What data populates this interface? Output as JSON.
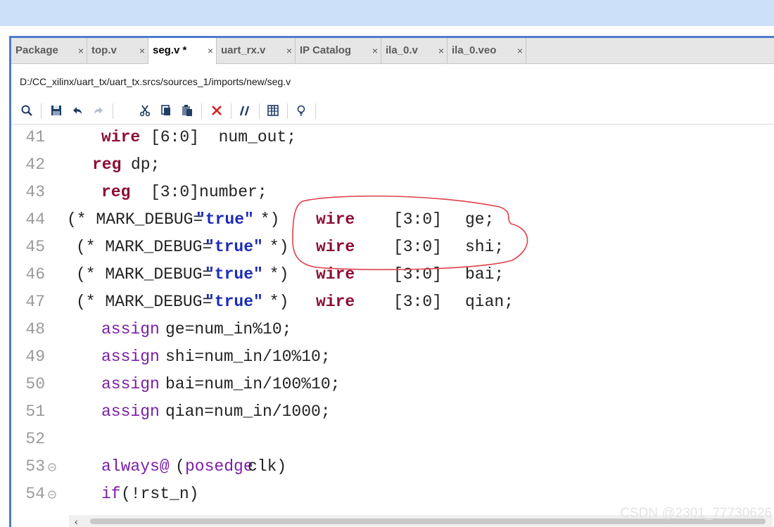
{
  "tabs": [
    {
      "label": "Package",
      "active": false
    },
    {
      "label": "top.v",
      "active": false
    },
    {
      "label": "seg.v *",
      "active": true
    },
    {
      "label": "uart_rx.v",
      "active": false
    },
    {
      "label": "IP Catalog",
      "active": false
    },
    {
      "label": "ila_0.v",
      "active": false
    },
    {
      "label": "ila_0.veo",
      "active": false
    }
  ],
  "tab_close_glyph": "×",
  "file_path": "D:/CC_xilinx/uart_tx/uart_tx.srcs/sources_1/imports/new/seg.v",
  "toolbar_icons": [
    "search-icon",
    "save-icon",
    "undo-icon",
    "redo-icon",
    "cut-icon",
    "copy-icon",
    "paste-icon",
    "delete-icon",
    "comment-icon",
    "columns-icon",
    "bulb-icon"
  ],
  "code": {
    "lines": [
      {
        "n": "41",
        "t": [
          "wire",
          "[6:0]  num_out;"
        ]
      },
      {
        "n": "42",
        "t": [
          "reg",
          "dp;"
        ]
      },
      {
        "n": "43",
        "t": [
          "reg",
          "[3:0]number;"
        ]
      },
      {
        "n": "44",
        "t": [
          "(* MARK_DEBUG=",
          "\"true\"",
          " *)",
          "wire",
          "[3:0]",
          "ge;"
        ]
      },
      {
        "n": "45",
        "t": [
          "(* MARK_DEBUG=",
          "\"true\"",
          " *)",
          "wire",
          "[3:0]",
          "shi;"
        ]
      },
      {
        "n": "46",
        "t": [
          "(* MARK_DEBUG=",
          "\"true\"",
          " *)",
          "wire",
          "[3:0]",
          "bai;"
        ]
      },
      {
        "n": "47",
        "t": [
          "(* MARK_DEBUG=",
          "\"true\"",
          " *)",
          "wire",
          "[3:0]",
          "qian;"
        ]
      },
      {
        "n": "48",
        "t": [
          "assign",
          "ge=num_in%10;"
        ]
      },
      {
        "n": "49",
        "t": [
          "assign",
          "shi=num_in/10%10;"
        ]
      },
      {
        "n": "50",
        "t": [
          "assign",
          "bai=num_in/100%10;"
        ]
      },
      {
        "n": "51",
        "t": [
          "assign",
          "qian=num_in/1000;"
        ]
      },
      {
        "n": "52",
        "t": []
      },
      {
        "n": "53",
        "t": [
          "always@",
          "(",
          "posedge",
          "clk)"
        ]
      },
      {
        "n": "54",
        "t": [
          "if",
          "(!rst_n)"
        ]
      }
    ]
  },
  "watermark": "CSDN @2301_77730626",
  "colors": {
    "accent": "#4c7bc9",
    "keyword": "#8c0e33",
    "keyword2": "#7a1fa6",
    "string": "#1b2bb8",
    "annotation": "#e0404a"
  }
}
